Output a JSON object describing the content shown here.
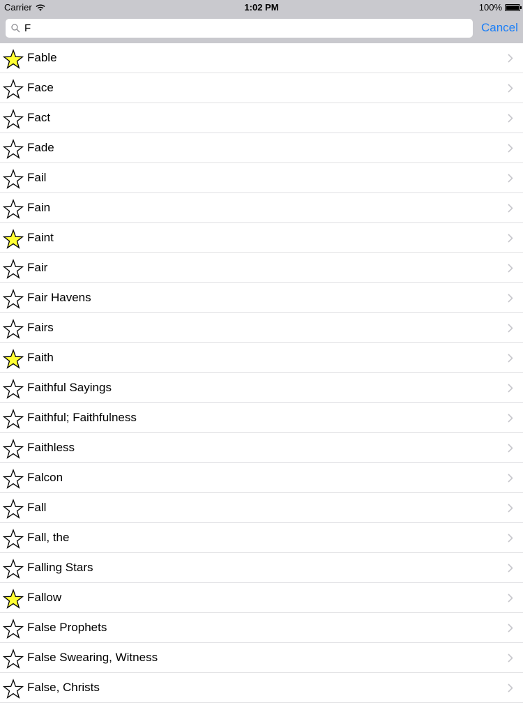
{
  "status": {
    "carrier": "Carrier",
    "time": "1:02 PM",
    "battery": "100%"
  },
  "search": {
    "value": "F",
    "cancel_label": "Cancel"
  },
  "colors": {
    "accent": "#1a7ef7",
    "star_fill": "#ffff33"
  },
  "items": [
    {
      "label": "Fable",
      "favorite": true
    },
    {
      "label": "Face",
      "favorite": false
    },
    {
      "label": "Fact",
      "favorite": false
    },
    {
      "label": "Fade",
      "favorite": false
    },
    {
      "label": "Fail",
      "favorite": false
    },
    {
      "label": "Fain",
      "favorite": false
    },
    {
      "label": "Faint",
      "favorite": true
    },
    {
      "label": "Fair",
      "favorite": false
    },
    {
      "label": "Fair Havens",
      "favorite": false
    },
    {
      "label": "Fairs",
      "favorite": false
    },
    {
      "label": "Faith",
      "favorite": true
    },
    {
      "label": "Faithful Sayings",
      "favorite": false
    },
    {
      "label": "Faithful; Faithfulness",
      "favorite": false
    },
    {
      "label": "Faithless",
      "favorite": false
    },
    {
      "label": "Falcon",
      "favorite": false
    },
    {
      "label": "Fall",
      "favorite": false
    },
    {
      "label": "Fall, the",
      "favorite": false
    },
    {
      "label": "Falling Stars",
      "favorite": false
    },
    {
      "label": "Fallow",
      "favorite": true
    },
    {
      "label": "False Prophets",
      "favorite": false
    },
    {
      "label": "False Swearing, Witness",
      "favorite": false
    },
    {
      "label": "False, Christs",
      "favorite": false
    }
  ]
}
